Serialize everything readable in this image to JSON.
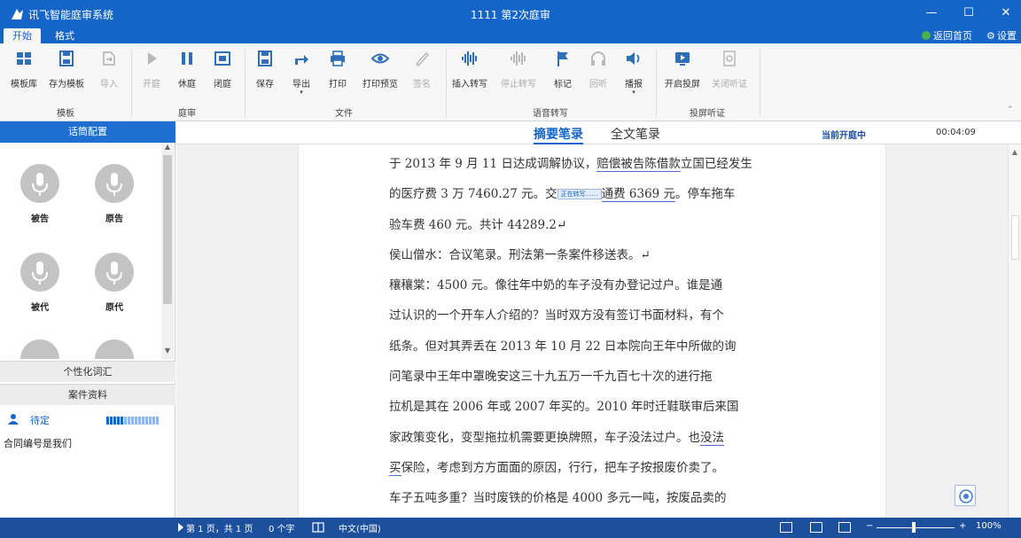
{
  "window": {
    "app_name": "讯飞智能庭审系统",
    "title": "1111 第2次庭审",
    "min_glyph": "—",
    "max_glyph": "☐",
    "close_glyph": "✕"
  },
  "tabs": {
    "start": "开始",
    "format": "格式",
    "home": "返回首页",
    "settings": "设置",
    "settings_glyph": "⚙"
  },
  "ribbon": {
    "template_library": "模板库",
    "save_as_template": "存为模板",
    "import": "导入",
    "open_trial": "开庭",
    "recess": "休庭",
    "close_trial": "闭庭",
    "save": "保存",
    "export": "导出",
    "print": "打印",
    "print_preview": "打印预览",
    "sign": "签名",
    "insert_transcript": "插入转写",
    "stop_transcript": "停止转写",
    "mark": "标记",
    "playback": "回听",
    "broadcast": "播报",
    "start_projection": "开启投屏",
    "close_projection": "关闭听证",
    "groups": {
      "template": "模板",
      "trial": "庭审",
      "file": "文件",
      "speech": "语音转写",
      "projection": "投屏听证"
    },
    "dropdown_glyph": "▾",
    "collapse_glyph": "⌃"
  },
  "left_panel": {
    "header": "话筒配置",
    "speakers": [
      {
        "label": "被告"
      },
      {
        "label": "原告"
      },
      {
        "label": "被代"
      },
      {
        "label": "原代"
      },
      {
        "label": ""
      },
      {
        "label": ""
      }
    ],
    "vocab": "个性化词汇",
    "case_materials": "案件资料",
    "active_speaker": "待定",
    "note": "合同编号是我们",
    "scroll_up": "▲",
    "scroll_down": "▼"
  },
  "document": {
    "tab_summary": "摘要笔录",
    "tab_full": "全文笔录",
    "status": "当前开庭中",
    "timer": "00:04:09",
    "lines": {
      "l1a": "于 2013 年 9 月 11 日达成调解协议，",
      "l1b": "赔偿被告陈借款",
      "l1c": "立国已经发生",
      "l2a": "的医疗费 3 万 7460.27 元。交",
      "l2tag": "正在转写……",
      "l2b": "通费 6369 元",
      "l2c": "。停车拖车",
      "l3": "验车费 460 元。共计 44289.2↵",
      "l4": "侯山僧水：合议笔录。刑法第一条案件移送表。↵",
      "l5": "穰穰棠：4500 元。像往年中奶的车子没有办登记过户。谁是通",
      "l6": "过认识的一个开车人介绍的？当时双方没有签订书面材料，有个",
      "l7": "纸条。但对其弄丢在 2013 年 10 月 22 日本院向王年中所做的询",
      "l8": "问笔录中王年中罩晚安这三十九五万一千九百七十次的进行拖",
      "l9": "拉机是其在 2006 年或 2007 年买的。2010 年时迁鞋联审后来国",
      "l10a": "家政策变化，变型拖拉机需要更换牌照，车子没法过户。也",
      "l10b": "没法",
      "l11a": "买",
      "l11b": "保险，考虑到方方面面的原因，行行，把车子按报废价卖了。",
      "l12": "车子五吨多重？当时废铁的价格是 4000 多元一吨，按废品卖的"
    },
    "scroll_up": "▲"
  },
  "statusbar": {
    "page": "第 1 页，共 1 页",
    "words": "0 个字",
    "language": "中文(中国)",
    "zoom_minus": "−",
    "zoom_plus": "+",
    "zoom": "100%"
  },
  "colors": {
    "brand": "#1565c9",
    "status_bar": "#1c4f9c",
    "ribbon_bg": "#f7f7f7"
  }
}
